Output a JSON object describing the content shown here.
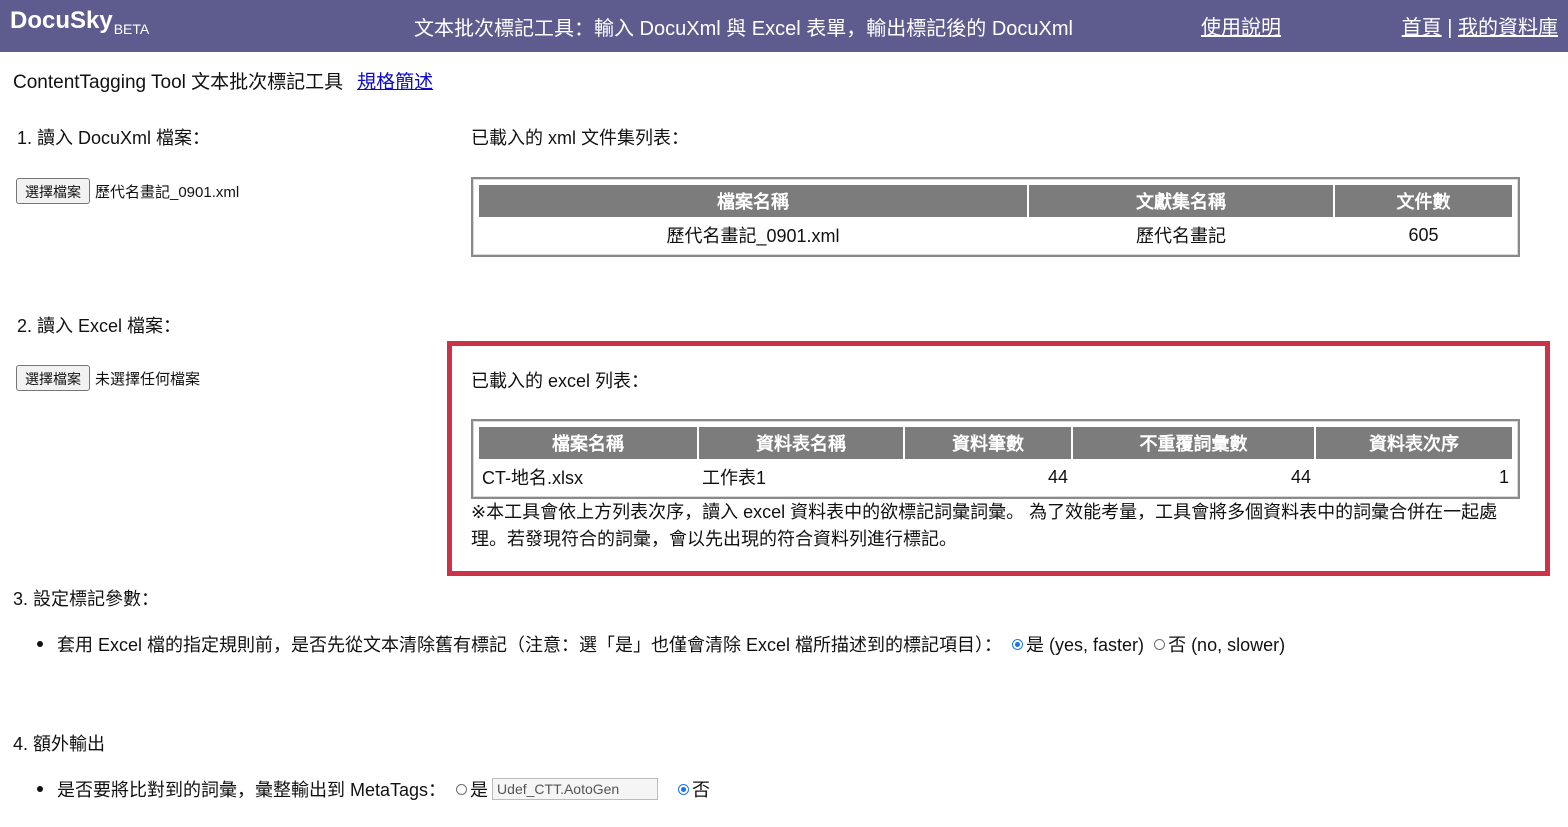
{
  "header": {
    "logo": "DocuSky",
    "logo_badge": "BETA",
    "title": "文本批次標記工具：輸入 DocuXml 與 Excel 表單，輸出標記後的 DocuXml",
    "help_link": "使用說明",
    "home_link": "首頁",
    "separator": "|",
    "my_db_link": "我的資料庫"
  },
  "page": {
    "title": "ContentTagging Tool 文本批次標記工具",
    "spec_link": "規格簡述"
  },
  "section1": {
    "label": "1. 讀入 DocuXml 檔案：",
    "file_button": "選擇檔案",
    "file_name": "歷代名畫記_0901.xml",
    "list_title": "已載入的 xml 文件集列表：",
    "table": {
      "headers": [
        "檔案名稱",
        "文獻集名稱",
        "文件數"
      ],
      "rows": [
        [
          "歷代名畫記_0901.xml",
          "歷代名畫記",
          "605"
        ]
      ]
    }
  },
  "section2": {
    "label": "2. 讀入 Excel 檔案：",
    "file_button": "選擇檔案",
    "file_name": "未選擇任何檔案",
    "list_title": "已載入的 excel 列表：",
    "table": {
      "headers": [
        "檔案名稱",
        "資料表名稱",
        "資料筆數",
        "不重覆詞彙數",
        "資料表次序"
      ],
      "rows": [
        [
          "CT-地名.xlsx",
          "工作表1",
          "44",
          "44",
          "1"
        ]
      ]
    },
    "note": "※本工具會依上方列表次序，讀入 excel 資料表中的欲標記詞彙詞彙。 為了效能考量，工具會將多個資料表中的詞彙合併在一起處理。若發現符合的詞彙，會以先出現的符合資料列進行標記。"
  },
  "section3": {
    "label": "3. 設定標記參數：",
    "question": "套用 Excel 檔的指定規則前，是否先從文本清除舊有標記（注意：選「是」也僅會清除 Excel 檔所描述到的標記項目）：",
    "option_yes": "是 (yes, faster)",
    "option_no": "否 (no, slower)",
    "selected": "yes"
  },
  "section4": {
    "label": "4. 額外輸出",
    "question": "是否要將比對到的詞彙，彙整輸出到 MetaTags：",
    "option_yes": "是",
    "input_value": "Udef_CTT.AotoGen",
    "option_no": "否",
    "selected": "no"
  }
}
